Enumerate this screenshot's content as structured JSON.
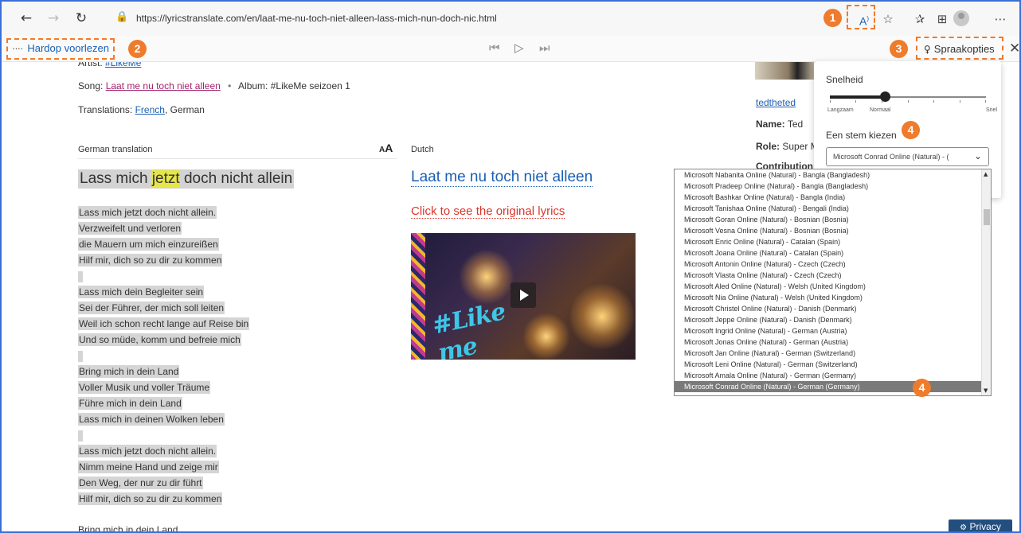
{
  "browser": {
    "url": "https://lyricstranslate.com/en/laat-me-nu-toch-niet-alleen-lass-mich-nun-doch-nic.html"
  },
  "read_aloud": {
    "label": "Hardop voorlezen",
    "voice_options_label": "Spraakopties"
  },
  "callouts": [
    "1",
    "2",
    "3",
    "4",
    "4"
  ],
  "page": {
    "artist_label": "Artist:",
    "artist_value": "#LikeMe",
    "song_label": "Song:",
    "song_value": "Laat me nu toch niet alleen",
    "album_label": "Album:",
    "album_value": "#LikeMe seizoen 1",
    "translations_label": "Translations:",
    "translation_french": "French",
    "translation_german": ", German",
    "german_header": "German translation",
    "dutch_header": "Dutch",
    "german_title_before": "Lass mich ",
    "german_title_highlight": "jetzt",
    "german_title_after": " doch nicht allein",
    "dutch_title": "Laat me nu toch niet alleen",
    "original_link": "Click to see the original lyrics",
    "stanzas": [
      [
        "Lass mich jetzt doch nicht allein.",
        "Verzweifelt und verloren",
        "die Mauern um mich einzureißen",
        "Hilf mir, dich so zu dir zu kommen"
      ],
      [
        "Lass mich dein Begleiter sein",
        "Sei der Führer, der mich soll leiten",
        "Weil ich schon recht lange auf Reise bin",
        "Und so müde, komm und befreie mich"
      ],
      [
        "Bring mich in dein Land",
        "Voller Musik und voller Träume",
        "Führe mich in dein Land",
        "Lass mich in deinen Wolken leben"
      ],
      [
        "Lass mich jetzt doch nicht allein.",
        "Nimm meine Hand und zeige mir",
        "Den Weg, der nur zu dir führt",
        "Hilf mir, dich so zu dir zu kommen"
      ]
    ],
    "last_line": "Bring mich in dein Land"
  },
  "sidebar": {
    "username": "tedtheted",
    "name_label": "Name:",
    "name_value": "Ted",
    "role_label": "Role:",
    "role_value": "Super M",
    "contributions_label": "Contribution:"
  },
  "voice_panel": {
    "speed_title": "Snelheid",
    "speed_slow": "Langzaam",
    "speed_normal": "Normaal",
    "speed_fast": "Snel",
    "speed_level": 0.35,
    "choose_voice": "Een stem kiezen",
    "selected_voice": "Microsoft Conrad Online (Natural) - (",
    "voices": [
      "Microsoft Nabanita Online (Natural) - Bangla (Bangladesh)",
      "Microsoft Pradeep Online (Natural) - Bangla (Bangladesh)",
      "Microsoft Bashkar Online (Natural) - Bangla (India)",
      "Microsoft Tanishaa Online (Natural) - Bengali (India)",
      "Microsoft Goran Online (Natural) - Bosnian (Bosnia)",
      "Microsoft Vesna Online (Natural) - Bosnian (Bosnia)",
      "Microsoft Enric Online (Natural) - Catalan (Spain)",
      "Microsoft Joana Online (Natural) - Catalan (Spain)",
      "Microsoft Antonin Online (Natural) - Czech (Czech)",
      "Microsoft Vlasta Online (Natural) - Czech (Czech)",
      "Microsoft Aled Online (Natural) - Welsh (United Kingdom)",
      "Microsoft Nia Online (Natural) - Welsh (United Kingdom)",
      "Microsoft Christel Online (Natural) - Danish (Denmark)",
      "Microsoft Jeppe Online (Natural) - Danish (Denmark)",
      "Microsoft Ingrid Online (Natural) - German (Austria)",
      "Microsoft Jonas Online (Natural) - German (Austria)",
      "Microsoft Jan Online (Natural) - German (Switzerland)",
      "Microsoft Leni Online (Natural) - German (Switzerland)",
      "Microsoft Amala Online (Natural) - German (Germany)",
      "Microsoft Conrad Online (Natural) - German (Germany)"
    ],
    "selected_index": 19
  },
  "privacy_label": "Privacy",
  "colors": {
    "accent": "#ef7b2c",
    "link": "#1a5fb4",
    "frame": "#3a6fd8"
  }
}
